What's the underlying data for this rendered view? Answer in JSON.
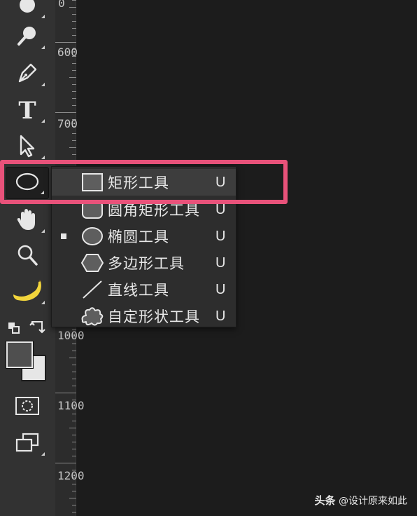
{
  "toolbar": {
    "tools": [
      {
        "icon": "blur-drop-icon"
      },
      {
        "icon": "magnifier-dodge-icon"
      },
      {
        "icon": "pen-icon"
      },
      {
        "icon": "type-icon",
        "glyph": "T"
      },
      {
        "icon": "path-selection-icon"
      },
      {
        "icon": "ellipse-icon",
        "active": true
      },
      {
        "icon": "hand-icon"
      },
      {
        "icon": "zoom-icon"
      },
      {
        "icon": "banana-icon"
      },
      {
        "icon": "default-colors-icon"
      },
      {
        "icon": "swap-colors-icon"
      },
      {
        "icon": "quick-mask-icon"
      },
      {
        "icon": "screen-mode-icon"
      }
    ],
    "colors": {
      "foreground": "#4f4f4f",
      "background": "#e6e6e6"
    }
  },
  "ruler": {
    "labels": [
      "0",
      "600",
      "700",
      "1000",
      "1100",
      "1200"
    ]
  },
  "menu": {
    "items": [
      {
        "label": "矩形工具",
        "key": "U",
        "icon": "rectangle-icon",
        "checked": false,
        "highlighted": true
      },
      {
        "label": "圆角矩形工具",
        "key": "U",
        "icon": "rounded-rectangle-icon",
        "checked": false
      },
      {
        "label": "椭圆工具",
        "key": "U",
        "icon": "ellipse-icon",
        "checked": true
      },
      {
        "label": "多边形工具",
        "key": "U",
        "icon": "polygon-icon",
        "checked": false
      },
      {
        "label": "直线工具",
        "key": "U",
        "icon": "line-icon",
        "checked": false
      },
      {
        "label": "自定形状工具",
        "key": "U",
        "icon": "custom-shape-icon",
        "checked": false
      }
    ]
  },
  "colors": {
    "accent": "#e8527a"
  },
  "watermark": {
    "brand": "头条",
    "handle": "@设计原来如此"
  }
}
